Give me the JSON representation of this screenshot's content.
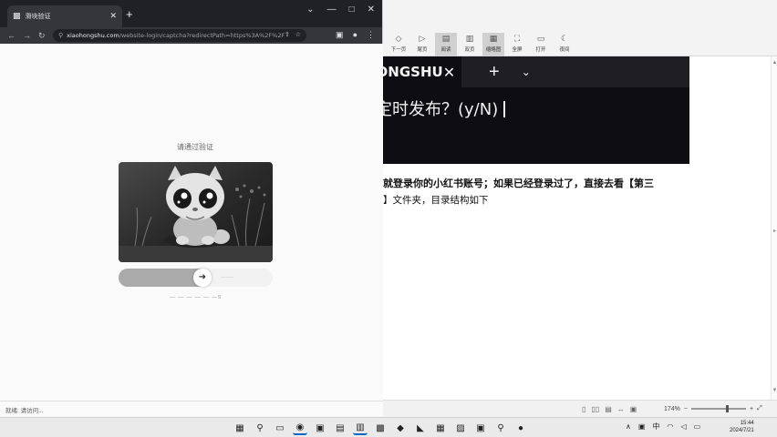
{
  "browser": {
    "tab_title": "滑块验证",
    "url_host": "xiaohongshu.com",
    "url_path": "/website-login/captcha?redirectPath=https%3A%2F%2F...",
    "status": "就绪: 请访问..."
  },
  "captcha": {
    "title": "请通过验证",
    "slider_hint": "——",
    "footer": "— — —  — — —s",
    "progress": 0.55
  },
  "terminal": {
    "tab_label": "HONGSHU",
    "prompt": "定时发布？(y/N)"
  },
  "document": {
    "line1": "就登录你的小红书账号；如果已经登录过了，直接去看【第三",
    "line2": "】文件夹，目录结构如下"
  },
  "ribbon": {
    "items": [
      "下一页",
      "尾页",
      "阅读",
      "双页",
      "缩略图",
      "全屏",
      "打开",
      "夜间"
    ]
  },
  "statusbar": {
    "zoom": "174%"
  },
  "taskbar": {
    "ime": "中",
    "time": "15:44",
    "date": "2024/7/21"
  },
  "colors": {
    "terminal_bg": "#0d0d12",
    "browser_dark": "#202124",
    "slider_fill": "#aaaaaa"
  }
}
